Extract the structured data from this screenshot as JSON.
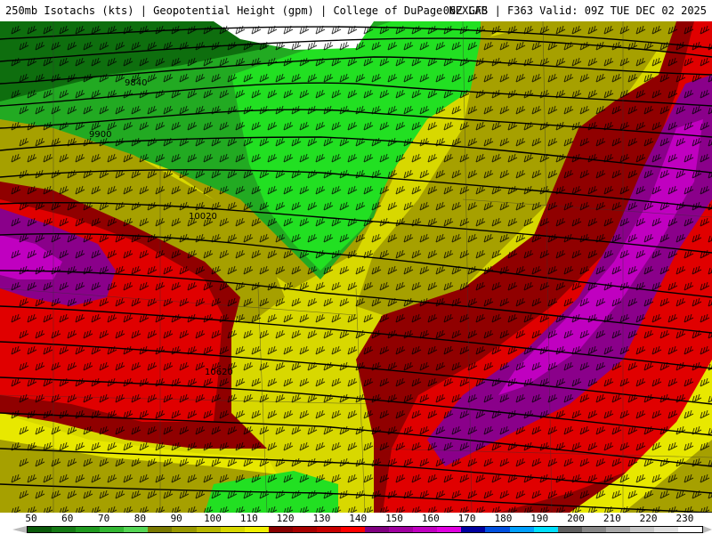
{
  "header": {
    "left_text": "250mb Isotachs (kts) | Geopotential Height (gpm) | College of DuPage NEXLAB",
    "right_text": "06Z GFS | F363 Valid: 09Z TUE DEC 02 2025"
  },
  "contours": {
    "label_9840": "9840",
    "label_9900": "9900",
    "label_10020": "10020",
    "label_10620": "10620"
  },
  "scale": {
    "ticks": [
      "50",
      "60",
      "70",
      "80",
      "90",
      "100",
      "110",
      "120",
      "130",
      "140",
      "150",
      "160",
      "170",
      "180",
      "190",
      "200",
      "210",
      "220",
      "230"
    ],
    "colors": [
      "#0a5a0a",
      "#157a15",
      "#1f9a1f",
      "#33b833",
      "#55d655",
      "#7a7a00",
      "#999900",
      "#b8b800",
      "#d8d800",
      "#f0f000",
      "#880000",
      "#a80000",
      "#c80000",
      "#ff0000",
      "#800080",
      "#a000a0",
      "#c000c0",
      "#e000e0",
      "#0000a0",
      "#0050e0",
      "#00a0ff",
      "#00e0ff",
      "#606060",
      "#888888",
      "#a8a8a8",
      "#c8c8c8",
      "#e0e0e0",
      "#ffffff"
    ]
  },
  "colors": {
    "green_dark": "#0e6e0e",
    "green_mid": "#22aa22",
    "green_bright": "#22e022",
    "olive": "#a6a000",
    "yellow": "#e8e800",
    "dark_red": "#900000",
    "red": "#e00000",
    "purple": "#8a008a",
    "magenta": "#c000c0",
    "white": "#ffffff"
  }
}
